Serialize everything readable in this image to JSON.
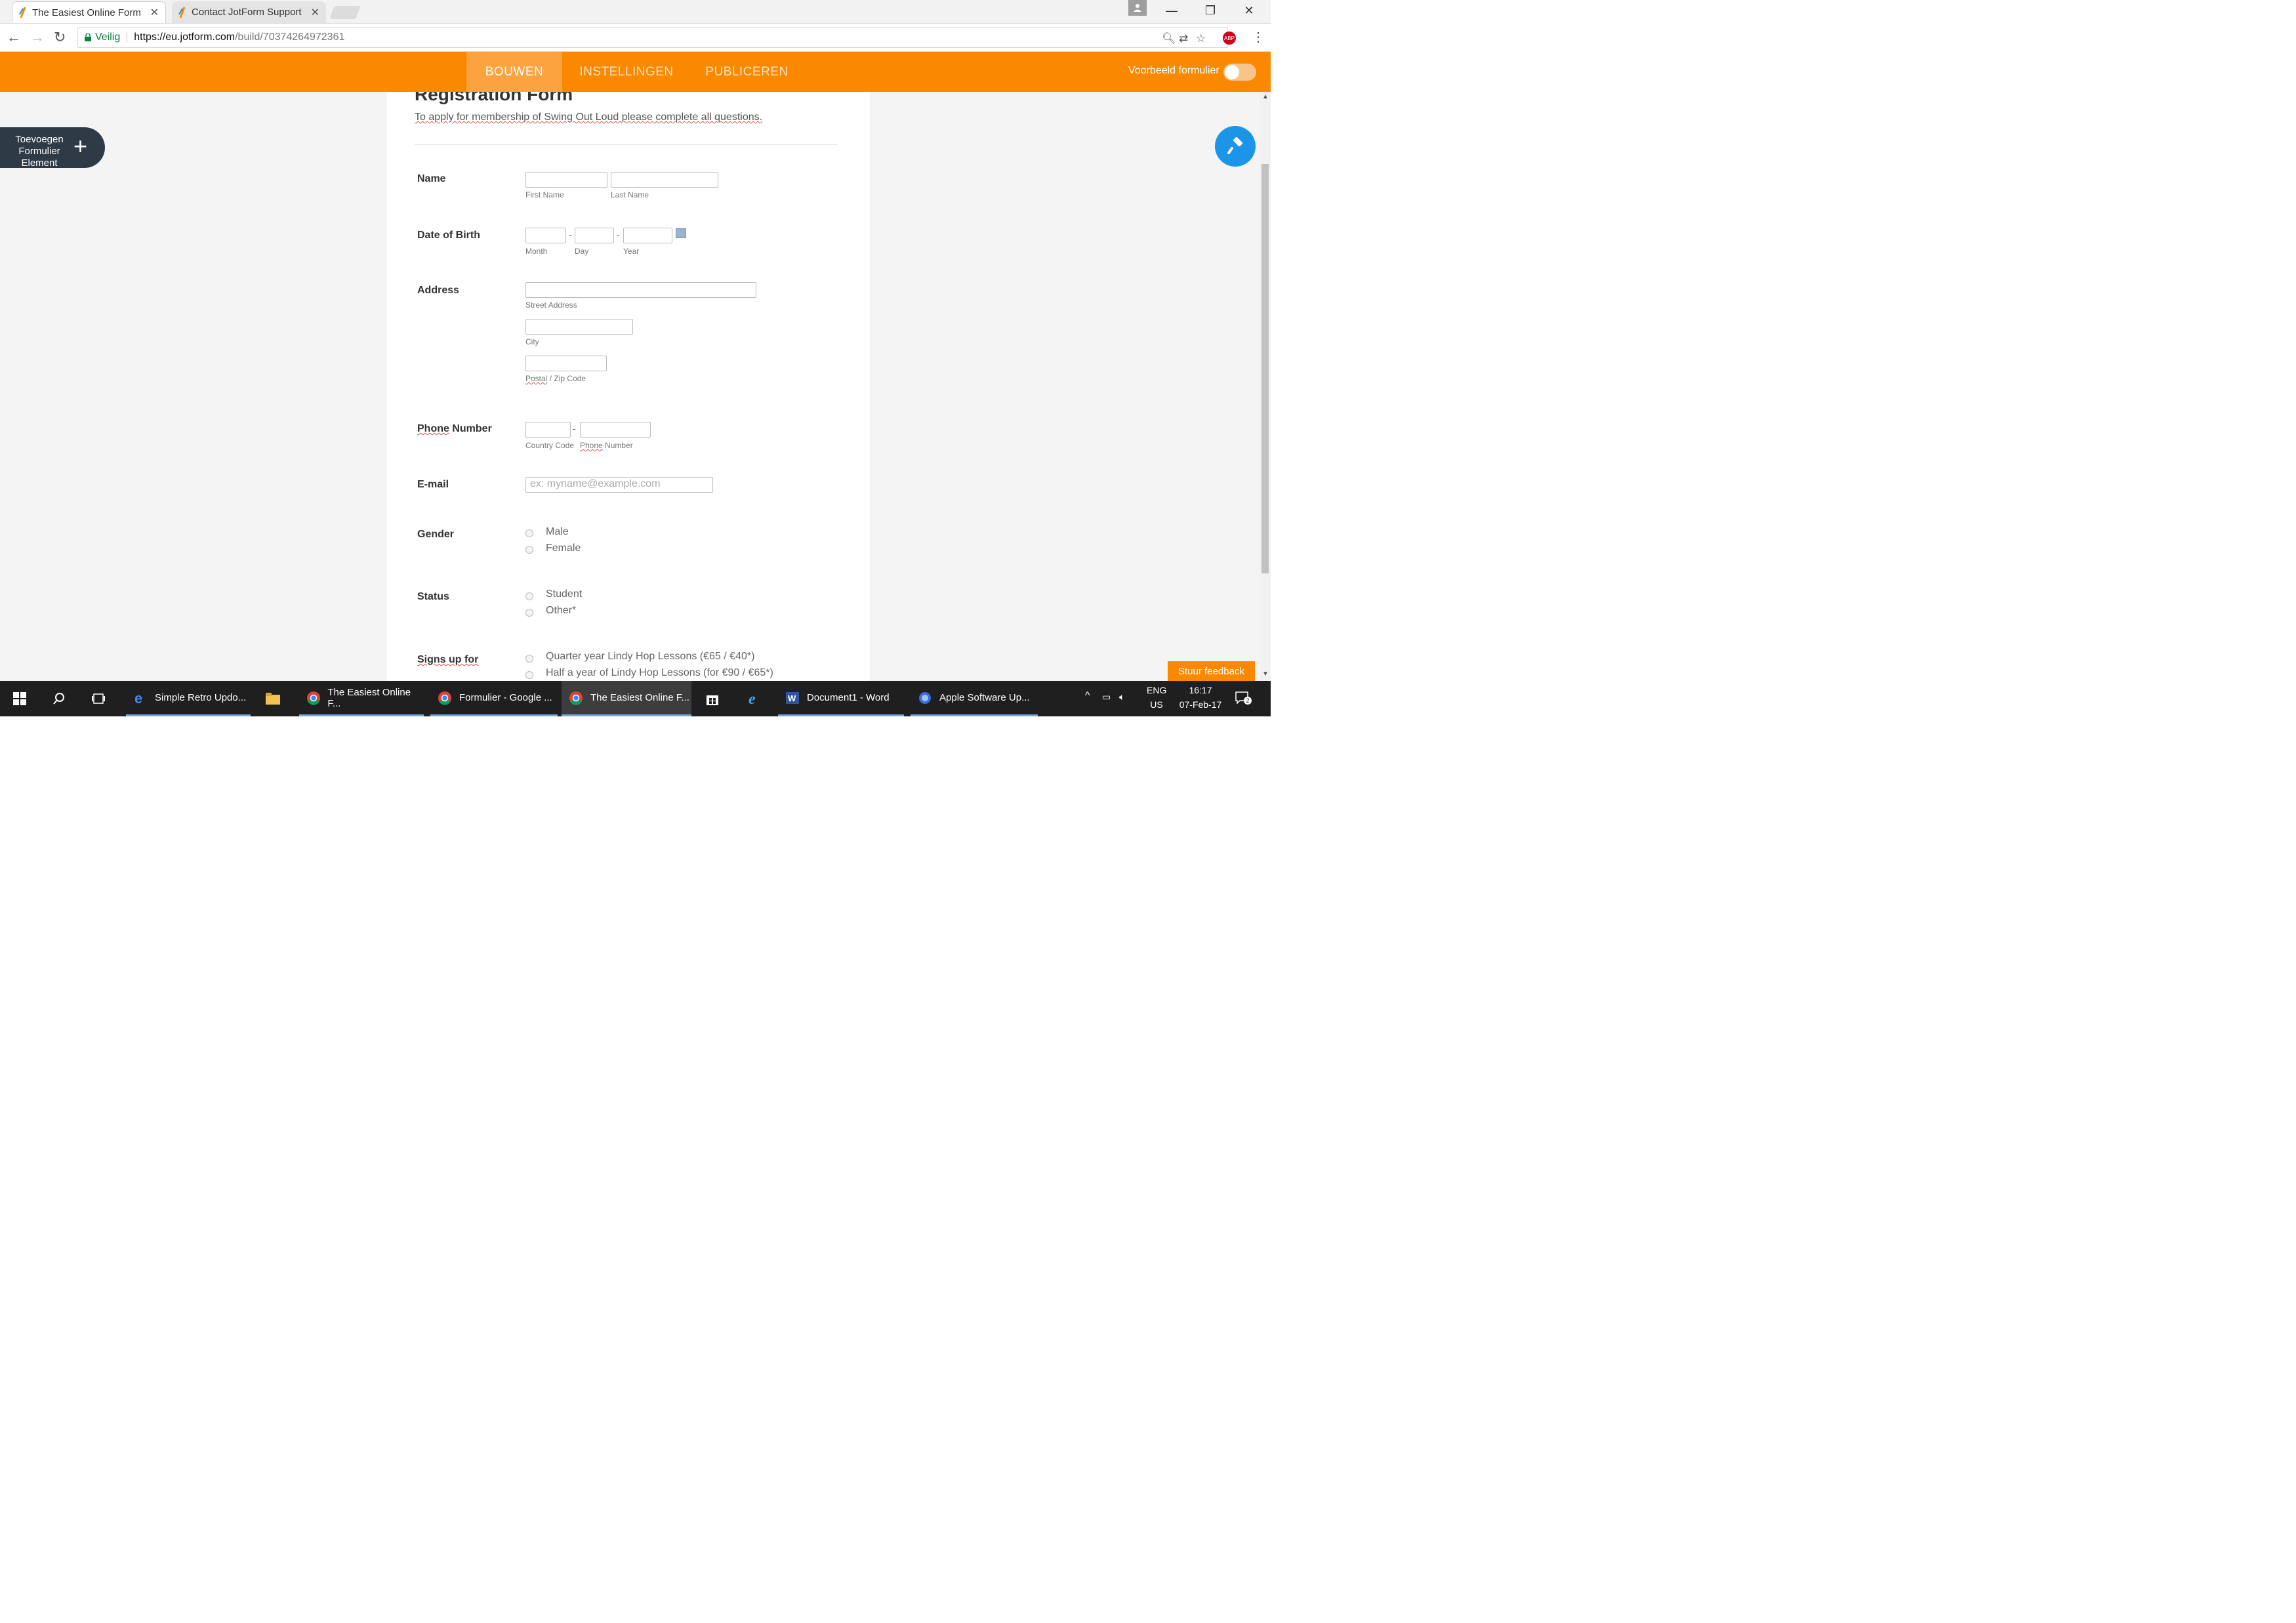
{
  "browser": {
    "tabs": [
      {
        "title": "The Easiest Online Form",
        "active": true
      },
      {
        "title": "Contact JotForm Support",
        "active": false
      }
    ],
    "secure_label": "Veilig",
    "url_host": "https://eu.jotform.com",
    "url_path": "/build/70374264972361"
  },
  "jotform": {
    "tabs": [
      "BOUWEN",
      "INSTELLINGEN",
      "PUBLICEREN"
    ],
    "preview_label": "Voorbeeld formulier",
    "preview_enabled": false,
    "add_element_label": "Toevoegen Formulier Element",
    "feedback_label": "Stuur feedback",
    "accent_color": "#fa8900",
    "paint_color": "#1b95e8"
  },
  "form": {
    "title": "Registration Form",
    "description": "To apply for membership of Swing Out Loud please complete all questions.",
    "name": {
      "label": "Name",
      "first": "First Name",
      "last": "Last Name"
    },
    "dob": {
      "label": "Date of Birth",
      "month": "Month",
      "day": "Day",
      "year": "Year"
    },
    "address": {
      "label": "Address",
      "street": "Street Address",
      "city": "City",
      "postal": "Postal",
      "zip": " / Zip Code"
    },
    "phone": {
      "label_word": "Phone",
      "label_rest": " Number",
      "country": "Country Code",
      "number_word": "Phone",
      "number_rest": " Number"
    },
    "email": {
      "label": "E-mail",
      "placeholder": "ex: myname@example.com"
    },
    "gender": {
      "label": "Gender",
      "options": [
        "Male",
        "Female"
      ]
    },
    "status": {
      "label": "Status",
      "options": [
        "Student",
        "Other*"
      ]
    },
    "signs_up": {
      "label": "Signs up for",
      "options": [
        "Quarter year Lindy Hop Lessons (€65 / €40*)",
        "Half a year of Lindy Hop Lessons (for €90 / €65*)"
      ]
    }
  },
  "taskbar": {
    "apps": [
      {
        "label": "Simple Retro Updo...",
        "icon": "edge-icon"
      },
      {
        "label": "The Easiest Online F...",
        "icon": "chrome-icon"
      },
      {
        "label": "Formulier - Google ...",
        "icon": "chrome-icon"
      },
      {
        "label": "The Easiest Online F...",
        "icon": "chrome-icon"
      },
      {
        "label": "Document1 - Word",
        "icon": "word-icon"
      },
      {
        "label": "Apple Software Up...",
        "icon": "apple-update-icon"
      }
    ],
    "lang": "ENG",
    "region": "US",
    "time": "16:17",
    "date": "07-Feb-17",
    "notifications": "2"
  }
}
